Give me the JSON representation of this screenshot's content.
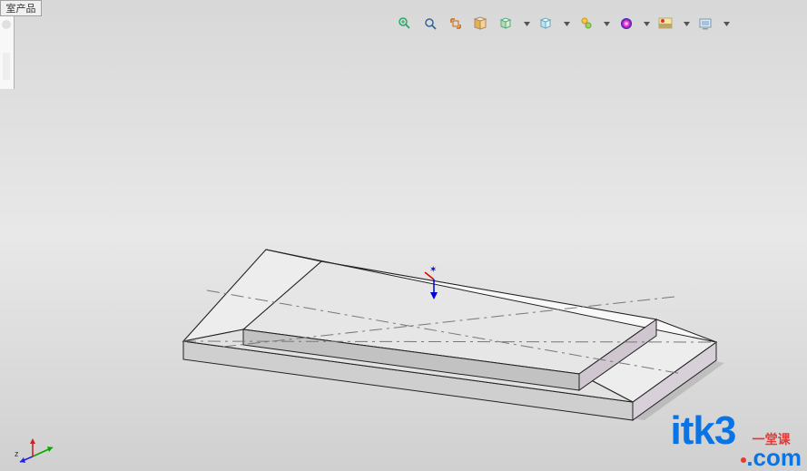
{
  "panel_fragment_label": "室产品",
  "toolbar": {
    "items": [
      {
        "name": "zoom-window-icon",
        "title": "Zoom to Window",
        "dropdown": false
      },
      {
        "name": "zoom-fit-icon",
        "title": "Zoom to Fit",
        "dropdown": false
      },
      {
        "name": "zoom-extents-icon",
        "title": "Previous View",
        "dropdown": false
      },
      {
        "name": "section-view-icon",
        "title": "Section View",
        "dropdown": false
      },
      {
        "name": "view-orientation-icon",
        "title": "View Orientation",
        "dropdown": true
      },
      {
        "name": "display-style-icon",
        "title": "Display Style",
        "dropdown": true
      },
      {
        "name": "hide-show-icon",
        "title": "Hide/Show Items",
        "dropdown": true
      },
      {
        "name": "edit-appearance-icon",
        "title": "Edit Appearance",
        "dropdown": true
      },
      {
        "name": "apply-scene-icon",
        "title": "Apply Scene",
        "dropdown": true
      },
      {
        "name": "view-settings-icon",
        "title": "View Settings",
        "dropdown": true
      }
    ]
  },
  "axis_label": "z",
  "watermark": {
    "main": "itk3",
    "suffix": ".com",
    "cn": "一堂课"
  }
}
